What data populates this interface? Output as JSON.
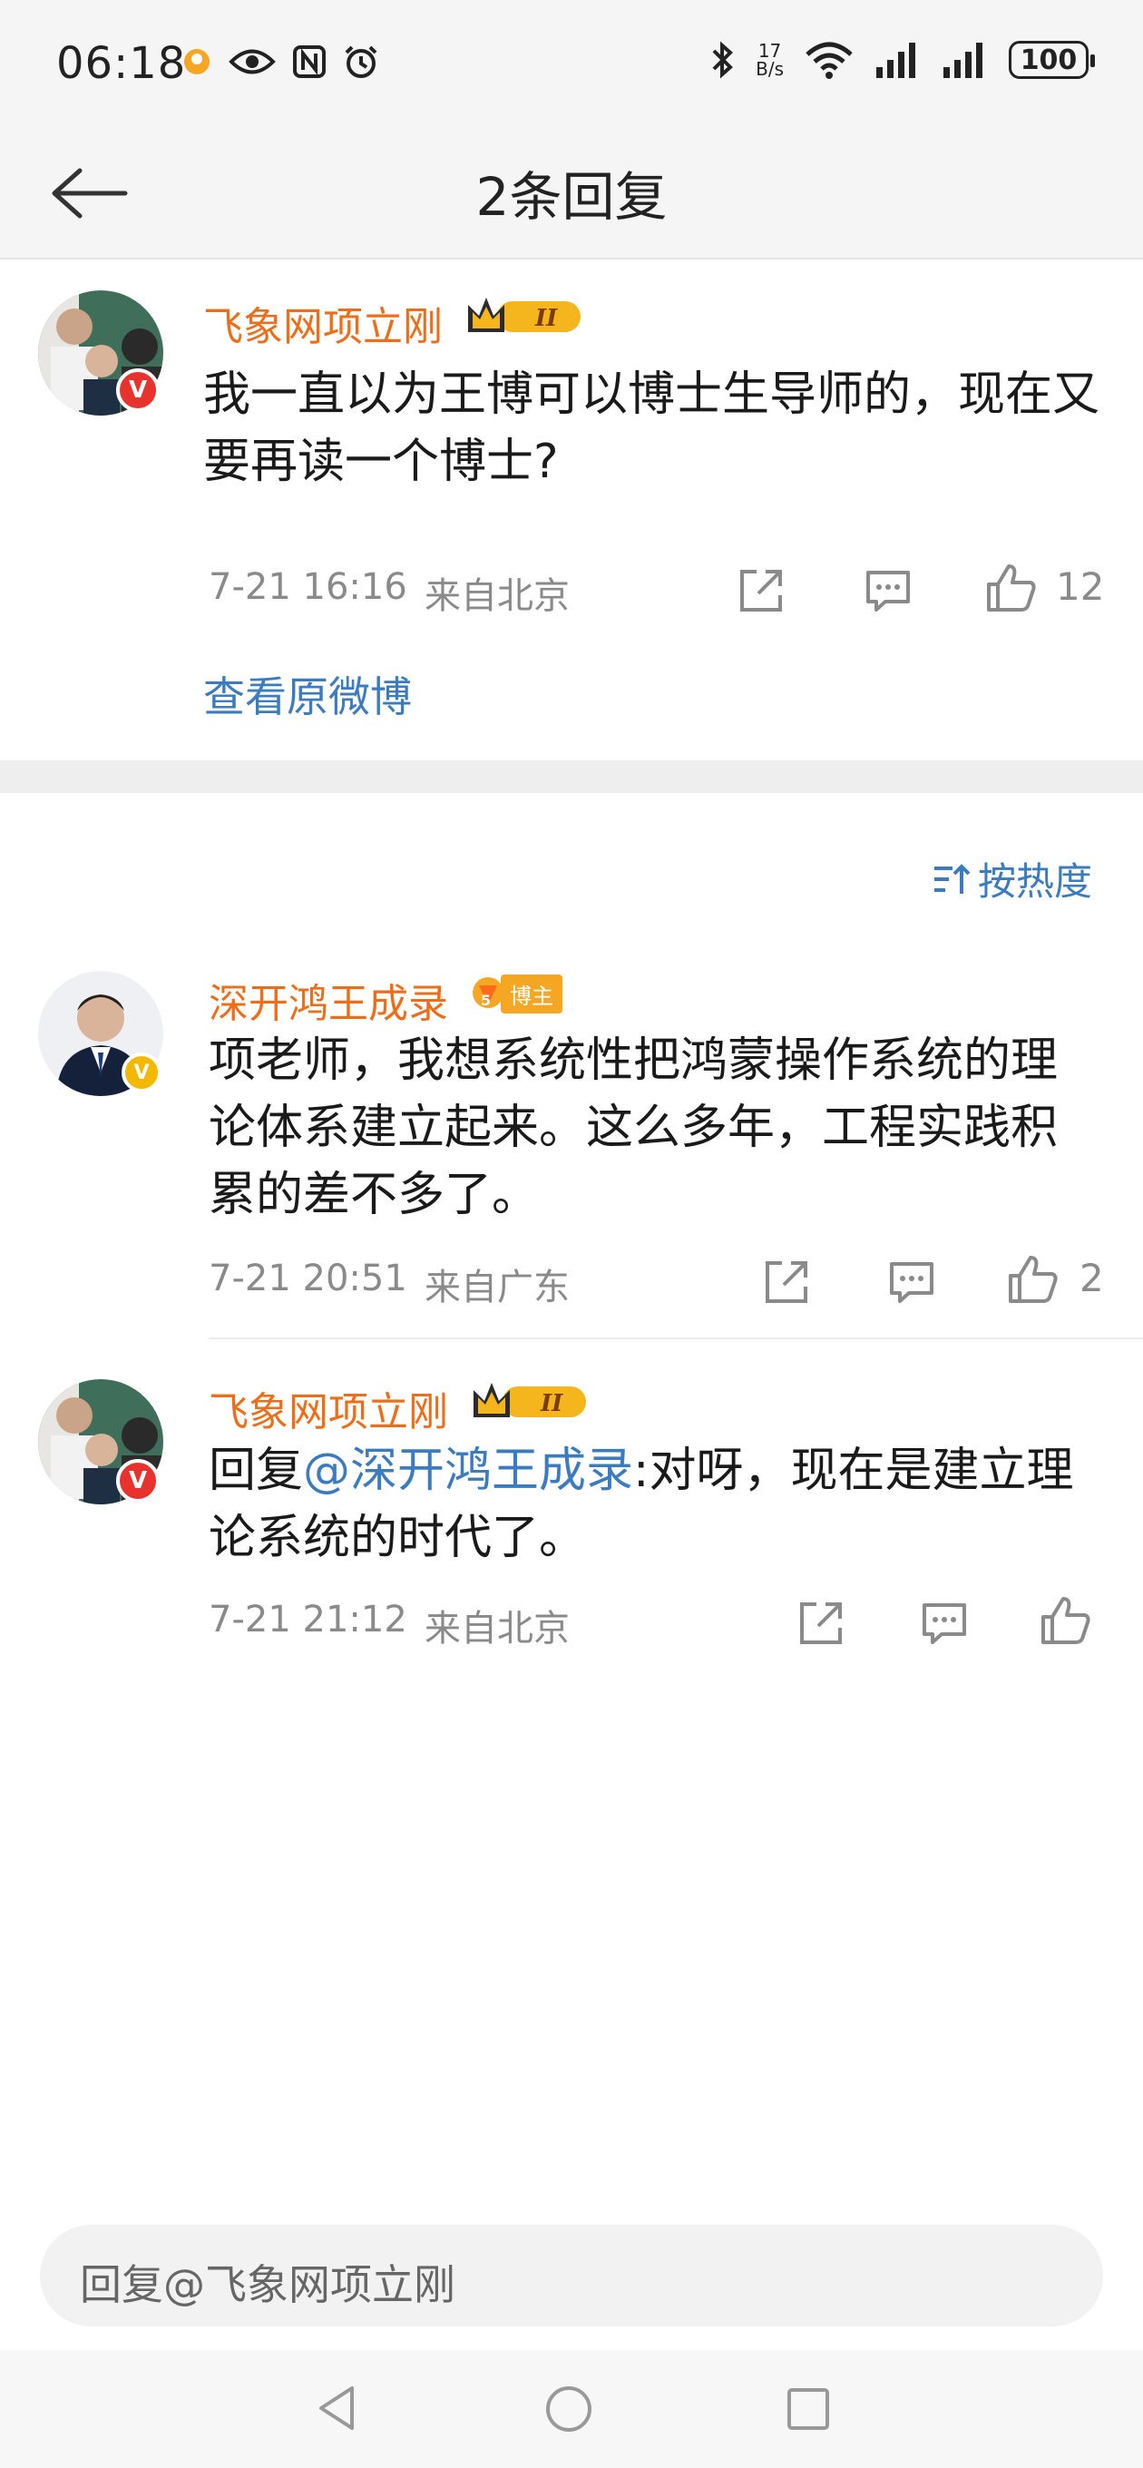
{
  "status_bar": {
    "time": "06:18",
    "speed_top": "17",
    "speed_bottom": "B/s",
    "battery": "100",
    "icons": [
      "app-notification-icon",
      "eye-icon",
      "nfc-icon",
      "alarm-icon",
      "bluetooth-icon",
      "wifi-icon",
      "signal-icon",
      "signal-icon"
    ]
  },
  "nav": {
    "title": "2条回复",
    "back_icon": "arrow-left-icon"
  },
  "original": {
    "username": "飞象网项立刚",
    "content": "我一直以为王博可以博士生导师的，现在又要再读一个博士?",
    "time": "7-21 16:16",
    "location": "来自北京",
    "likes": "12",
    "view_original": "查看原微博"
  },
  "sort": {
    "label": "按热度"
  },
  "replies": [
    {
      "username": "深开鸿王成录",
      "badge_label": "博主",
      "content": "项老师，我想系统性把鸿蒙操作系统的理论体系建立起来。这么多年，工程实践积累的差不多了。",
      "time": "7-21 20:51",
      "location": "来自广东",
      "likes": "2"
    },
    {
      "username": "飞象网项立刚",
      "content_prefix": "回复",
      "mention": "@深开鸿王成录",
      "content_suffix": ":对呀，现在是建立理论系统的时代了。",
      "time": "7-21 21:12",
      "location": "来自北京"
    }
  ],
  "reply_input": {
    "placeholder": "回复@飞象网项立刚"
  },
  "colors": {
    "username": "#ee6d19",
    "link": "#3b7bbf",
    "meta": "#8a8a8a"
  }
}
